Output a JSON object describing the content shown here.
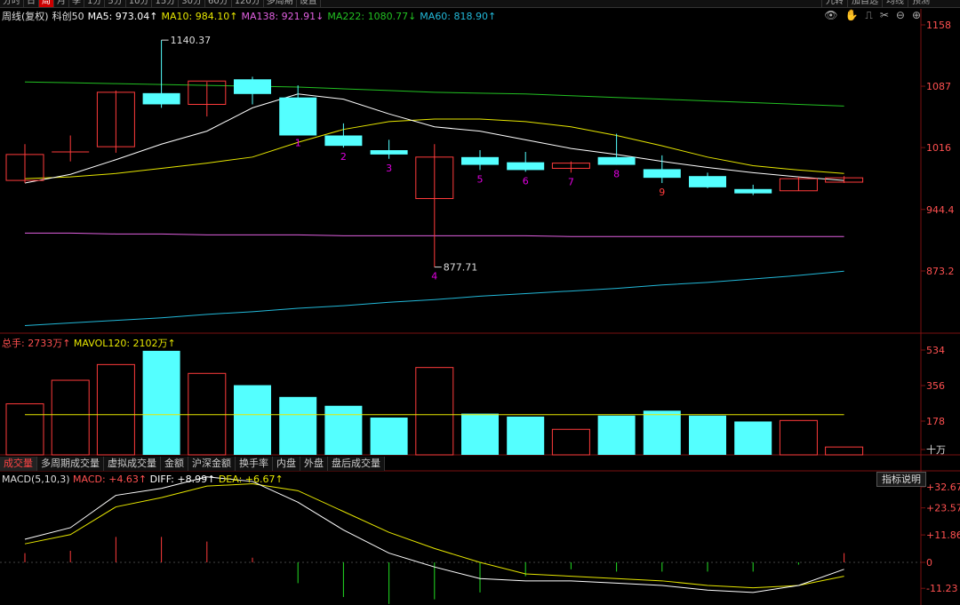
{
  "top_tabs": [
    "分时",
    "日",
    "周",
    "月",
    "季",
    "1分",
    "5分",
    "10分",
    "15分",
    "30分",
    "60分",
    "120分",
    "多周期",
    "设置"
  ],
  "top_tabs_active": "周",
  "top_right_tabs": [
    "九转",
    "加自选",
    "均线",
    "预测"
  ],
  "legend": {
    "period": "周线(复权)",
    "name": "科创50",
    "ma5": "MA5: 973.04↑",
    "ma10": "MA10: 984.10↑",
    "ma138": "MA138: 921.91↓",
    "ma222": "MA222: 1080.77↓",
    "ma60": "MA60: 818.90↑"
  },
  "colors": {
    "up": "#ff3b3b",
    "down": "#54ffff",
    "ma5": "#ffffff",
    "ma10": "#e6e600",
    "ma138": "#e060e0",
    "ma222": "#22c022",
    "ma60": "#22b8d8",
    "grid": "#7a1010",
    "label_red": "#ff5050",
    "seq_magenta": "#e000e0",
    "seq_red": "#ff3b3b"
  },
  "price_axis": [
    "1158",
    "1087",
    "1016",
    "944.4",
    "873.2"
  ],
  "high_label": "1140.37",
  "low_label": "877.71",
  "candles": [
    {
      "o": 978,
      "h": 1020,
      "l": 975,
      "c": 1008,
      "up": true
    },
    {
      "o": 1010,
      "h": 1030,
      "l": 1000,
      "c": 1011,
      "up": true,
      "cross": true
    },
    {
      "o": 1017,
      "h": 1082,
      "l": 1010,
      "c": 1080,
      "up": true
    },
    {
      "o": 1079,
      "h": 1140.37,
      "l": 1062,
      "c": 1066,
      "up": false
    },
    {
      "o": 1066,
      "h": 1092,
      "l": 1052,
      "c": 1093,
      "up": true
    },
    {
      "o": 1095,
      "h": 1098,
      "l": 1066,
      "c": 1078,
      "up": false
    },
    {
      "o": 1074,
      "h": 1088,
      "l": 1032,
      "c": 1030,
      "up": false
    },
    {
      "o": 1030,
      "h": 1044,
      "l": 1016,
      "c": 1018,
      "up": false
    },
    {
      "o": 1013,
      "h": 1025,
      "l": 1003,
      "c": 1008,
      "up": false
    },
    {
      "o": 957,
      "h": 1020,
      "l": 877.71,
      "c": 1005,
      "up": true
    },
    {
      "o": 1005,
      "h": 1013,
      "l": 990,
      "c": 996,
      "up": false
    },
    {
      "o": 999,
      "h": 1011,
      "l": 988,
      "c": 990,
      "up": false
    },
    {
      "o": 992,
      "h": 1000,
      "l": 987,
      "c": 998,
      "up": true
    },
    {
      "o": 1005,
      "h": 1032,
      "l": 996,
      "c": 996,
      "up": false
    },
    {
      "o": 991,
      "h": 1007,
      "l": 975,
      "c": 981,
      "up": false
    },
    {
      "o": 983,
      "h": 987,
      "l": 969,
      "c": 970,
      "up": false
    },
    {
      "o": 968,
      "h": 973,
      "l": 961,
      "c": 963,
      "up": false
    },
    {
      "o": 966,
      "h": 982,
      "l": 966,
      "c": 980,
      "up": true
    },
    {
      "o": 976,
      "h": 983,
      "l": 975,
      "c": 981,
      "up": true
    }
  ],
  "seq_labels": [
    {
      "i": 6,
      "t": "1",
      "c": "magenta"
    },
    {
      "i": 7,
      "t": "2",
      "c": "magenta"
    },
    {
      "i": 8,
      "t": "3",
      "c": "magenta"
    },
    {
      "i": 9,
      "t": "4",
      "c": "magenta"
    },
    {
      "i": 10,
      "t": "5",
      "c": "magenta"
    },
    {
      "i": 11,
      "t": "6",
      "c": "magenta"
    },
    {
      "i": 12,
      "t": "7",
      "c": "magenta"
    },
    {
      "i": 13,
      "t": "8",
      "c": "magenta"
    },
    {
      "i": 14,
      "t": "9",
      "c": "red"
    }
  ],
  "ma": {
    "ma5": [
      975,
      985,
      1002,
      1020,
      1035,
      1062,
      1078,
      1072,
      1055,
      1040,
      1035,
      1025,
      1015,
      1008,
      1000,
      993,
      987,
      982,
      978
    ],
    "ma10": [
      980,
      982,
      986,
      992,
      998,
      1005,
      1022,
      1037,
      1046,
      1049,
      1049,
      1046,
      1040,
      1030,
      1018,
      1005,
      995,
      990,
      986
    ],
    "ma222": [
      1092,
      1091,
      1090,
      1089,
      1088,
      1087,
      1086,
      1084,
      1082,
      1080,
      1079,
      1078,
      1076,
      1074,
      1072,
      1070,
      1068,
      1066,
      1064
    ],
    "ma138": [
      917,
      917,
      916,
      916,
      915,
      915,
      915,
      914,
      914,
      914,
      914,
      914,
      913,
      913,
      913,
      913,
      913,
      913,
      913
    ],
    "ma60": [
      810,
      813,
      816,
      819,
      823,
      826,
      830,
      833,
      837,
      840,
      844,
      847,
      850,
      853,
      857,
      860,
      864,
      868,
      873
    ]
  },
  "volume": {
    "legend_total": "总手: 2733万↑",
    "legend_mavol": "MAVOL120: 2102万↑",
    "axis": [
      "534",
      "356",
      "178",
      "十万"
    ],
    "mavol120": 205,
    "values": [
      260,
      380,
      460,
      530,
      415,
      355,
      295,
      250,
      190,
      445,
      210,
      195,
      130,
      200,
      225,
      200,
      170,
      175,
      40
    ],
    "tabs": [
      "成交量",
      "多周期成交量",
      "虚拟成交量",
      "金额",
      "沪深金额",
      "换手率",
      "内盘",
      "外盘",
      "盘后成交量"
    ],
    "active_tab": "成交量"
  },
  "macd": {
    "legend_name": "MACD(5,10,3)",
    "legend_macd": "MACD: +4.63↑",
    "legend_diff": "DIFF: +8.99↑",
    "legend_dea": "DEA: +6.67↑",
    "indicator_button": "指标说明",
    "axis": [
      "+32.67",
      "+23.57",
      "+11.86",
      "0",
      "-11.23"
    ],
    "diff": [
      10,
      15,
      29,
      32,
      37,
      35,
      26,
      14,
      4,
      -2,
      -7,
      -8,
      -8,
      -9,
      -10,
      -12,
      -13,
      -10,
      -3
    ],
    "dea": [
      8,
      12,
      24,
      28,
      33,
      34,
      31,
      22,
      13,
      6,
      0,
      -5,
      -6,
      -7,
      -8,
      -10,
      -11,
      -10,
      -6
    ],
    "bars": [
      4,
      5,
      11,
      11,
      9,
      2,
      -9,
      -15,
      -18,
      -16,
      -13,
      -6,
      -3,
      -4,
      -4,
      -4,
      -4,
      -1,
      4
    ]
  }
}
